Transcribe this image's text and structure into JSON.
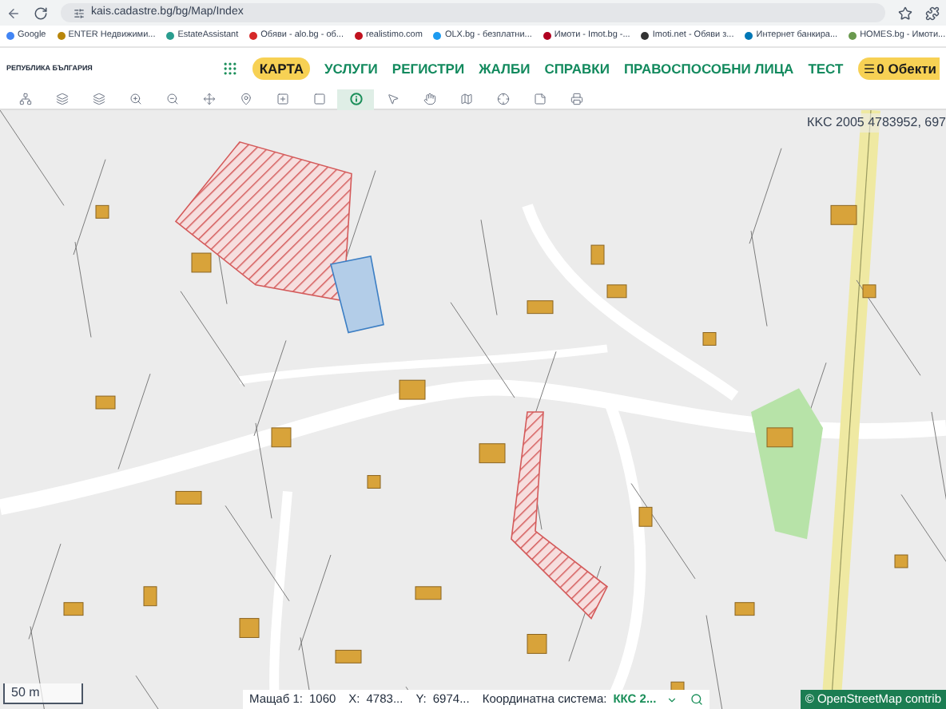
{
  "browser": {
    "url": "kais.cadastre.bg/bg/Map/Index",
    "bookmarks": [
      {
        "label": "Google"
      },
      {
        "label": "ENTER Недвижими..."
      },
      {
        "label": "EstateAssistant"
      },
      {
        "label": "Обяви - alo.bg - об..."
      },
      {
        "label": "realistimo.com"
      },
      {
        "label": "OLX.bg - безплатни..."
      },
      {
        "label": "Имоти - Imot.bg -..."
      },
      {
        "label": "Imoti.net - Обяви з..."
      },
      {
        "label": "Интернет банкира..."
      },
      {
        "label": "HOMES.bg - Имоти..."
      }
    ]
  },
  "header": {
    "logo_title": "РЕПУБЛИКА БЪЛГАРИЯ",
    "nav": [
      {
        "label": "КАРТА",
        "selected": true
      },
      {
        "label": "УСЛУГИ",
        "selected": false
      },
      {
        "label": "РЕГИСТРИ",
        "selected": false
      },
      {
        "label": "ЖАЛБИ",
        "selected": false
      },
      {
        "label": "СПРАВКИ",
        "selected": false
      },
      {
        "label": "ПРАВОСПОСОБНИ ЛИЦА",
        "selected": false
      },
      {
        "label": "ТЕСТ",
        "selected": false
      }
    ],
    "objects_button": "0 Обекти"
  },
  "toolbar": {
    "tools": [
      {
        "kind": "network",
        "selected": false
      },
      {
        "kind": "layers-base",
        "selected": false
      },
      {
        "kind": "layers",
        "selected": false
      },
      {
        "kind": "zoom-in",
        "selected": false
      },
      {
        "kind": "zoom-out",
        "selected": false
      },
      {
        "kind": "pan",
        "selected": false
      },
      {
        "kind": "pin",
        "selected": false
      },
      {
        "kind": "select-add",
        "selected": false
      },
      {
        "kind": "select",
        "selected": false
      },
      {
        "kind": "info",
        "selected": true
      },
      {
        "kind": "pointer",
        "selected": false
      },
      {
        "kind": "hand",
        "selected": false
      },
      {
        "kind": "map",
        "selected": false
      },
      {
        "kind": "cross",
        "selected": false
      },
      {
        "kind": "note",
        "selected": false
      },
      {
        "kind": "print",
        "selected": false
      }
    ]
  },
  "map": {
    "coordinates": "КKС 2005 4783952, 697",
    "scale": "50 m",
    "attribution": "© OpenStreetMap contrib"
  },
  "status_bar": {
    "scale_label": "Мащаб 1:",
    "scale_value": "1060",
    "x_label": "X:",
    "x_value": "4783...",
    "y_label": "Y:",
    "y_value": "6974...",
    "crs_label": "Координатна система:",
    "crs_value": "ККС 2..."
  }
}
